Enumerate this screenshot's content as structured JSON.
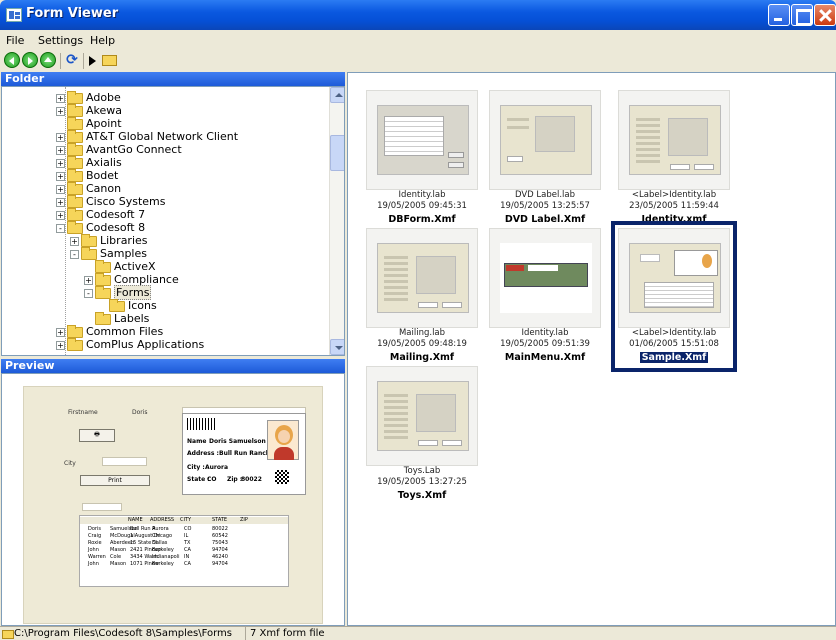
{
  "window": {
    "title": "Form Viewer"
  },
  "menu": {
    "file": "File",
    "settings": "Settings",
    "help": "Help"
  },
  "panels": {
    "folder": "Folder",
    "preview": "Preview"
  },
  "tree": [
    {
      "label": "Adobe",
      "indent": 1,
      "exp": "+"
    },
    {
      "label": "Akewa",
      "indent": 1,
      "exp": "+"
    },
    {
      "label": "Apoint",
      "indent": 1,
      "exp": ""
    },
    {
      "label": "AT&T Global Network Client",
      "indent": 1,
      "exp": "+"
    },
    {
      "label": "AvantGo Connect",
      "indent": 1,
      "exp": "+"
    },
    {
      "label": "Axialis",
      "indent": 1,
      "exp": "+"
    },
    {
      "label": "Bodet",
      "indent": 1,
      "exp": "+"
    },
    {
      "label": "Canon",
      "indent": 1,
      "exp": "+"
    },
    {
      "label": "Cisco Systems",
      "indent": 1,
      "exp": "+"
    },
    {
      "label": "Codesoft 7",
      "indent": 1,
      "exp": "+"
    },
    {
      "label": "Codesoft 8",
      "indent": 1,
      "exp": "-"
    },
    {
      "label": "Libraries",
      "indent": 2,
      "exp": "+"
    },
    {
      "label": "Samples",
      "indent": 2,
      "exp": "-"
    },
    {
      "label": "ActiveX",
      "indent": 3,
      "exp": ""
    },
    {
      "label": "Compliance",
      "indent": 3,
      "exp": "+"
    },
    {
      "label": "Forms",
      "indent": 3,
      "exp": "-",
      "selected": true
    },
    {
      "label": "Icons",
      "indent": 4,
      "exp": ""
    },
    {
      "label": "Labels",
      "indent": 3,
      "exp": ""
    },
    {
      "label": "Common Files",
      "indent": 1,
      "exp": "+"
    },
    {
      "label": "ComPlus Applications",
      "indent": 1,
      "exp": "+"
    }
  ],
  "preview": {
    "firstname_label": "Firstname",
    "firstname_value": "Doris",
    "city_label": "City",
    "print_label": "Print",
    "card": {
      "name_label": "Name",
      "name_value": "Doris Samuelson",
      "address_label": "Address :",
      "address_value": "Bull Run Ranch",
      "city_label": "City :",
      "city_value": "Aurora",
      "state_label": "State :",
      "state_value": "CO",
      "zip_label": "Zip :",
      "zip_value": "80022"
    },
    "table": {
      "headers": [
        "NAME",
        "ADDRESS",
        "CITY",
        "STATE",
        "ZIP"
      ],
      "rows": [
        [
          "Doris",
          "Samuelson",
          "Bull Run R",
          "Aurora",
          "CO",
          "80022"
        ],
        [
          "Craig",
          "McDougal",
          "1 August Dr",
          "Chicago",
          "IL",
          "60542"
        ],
        [
          "Roxie",
          "Aberdeen",
          "15 State St",
          "Dallas",
          "TX",
          "75043"
        ],
        [
          "John",
          "Mason",
          "2421 Pincup",
          "Berkeley",
          "CA",
          "94704"
        ],
        [
          "Warren",
          "Cole",
          "3434 Wash.",
          "Indianapoli",
          "IN",
          "46240"
        ],
        [
          "John",
          "Mason",
          "1071 Pinew",
          "Berkeley",
          "CA",
          "94704"
        ]
      ]
    }
  },
  "thumbnails": [
    {
      "cap1": "Identity.lab",
      "cap2": "19/05/2005 09:45:31",
      "name": "DBForm.Xmf",
      "style": "grid"
    },
    {
      "cap1": "DVD Label.lab",
      "cap2": "19/05/2005 13:25:57",
      "name": "DVD Label.Xmf",
      "style": "dvd"
    },
    {
      "cap1": "<Label>Identity.lab",
      "cap2": "23/05/2005 11:59:44",
      "name": "Identity.xmf",
      "style": "identity"
    },
    {
      "cap1": "Mailing.lab",
      "cap2": "19/05/2005 09:48:19",
      "name": "Mailing.Xmf",
      "style": "mailing"
    },
    {
      "cap1": "Identity.lab",
      "cap2": "19/05/2005 09:51:39",
      "name": "MainMenu.Xmf",
      "style": "menu"
    },
    {
      "cap1": "<Label>Identity.lab",
      "cap2": "01/06/2005 15:51:08",
      "name": "Sample.Xmf",
      "style": "sample",
      "selected": true
    },
    {
      "cap1": "Toys.Lab",
      "cap2": "19/05/2005 13:27:25",
      "name": "Toys.Xmf",
      "style": "toys"
    }
  ],
  "status": {
    "path": "C:\\Program Files\\Codesoft 8\\Samples\\Forms",
    "type": "7 Xmf form file"
  },
  "colors": {
    "title_bar": "#0A58E0",
    "panel_header": "#3F7EF2",
    "selection": "#0A246A",
    "folder": "#F6D55A"
  }
}
